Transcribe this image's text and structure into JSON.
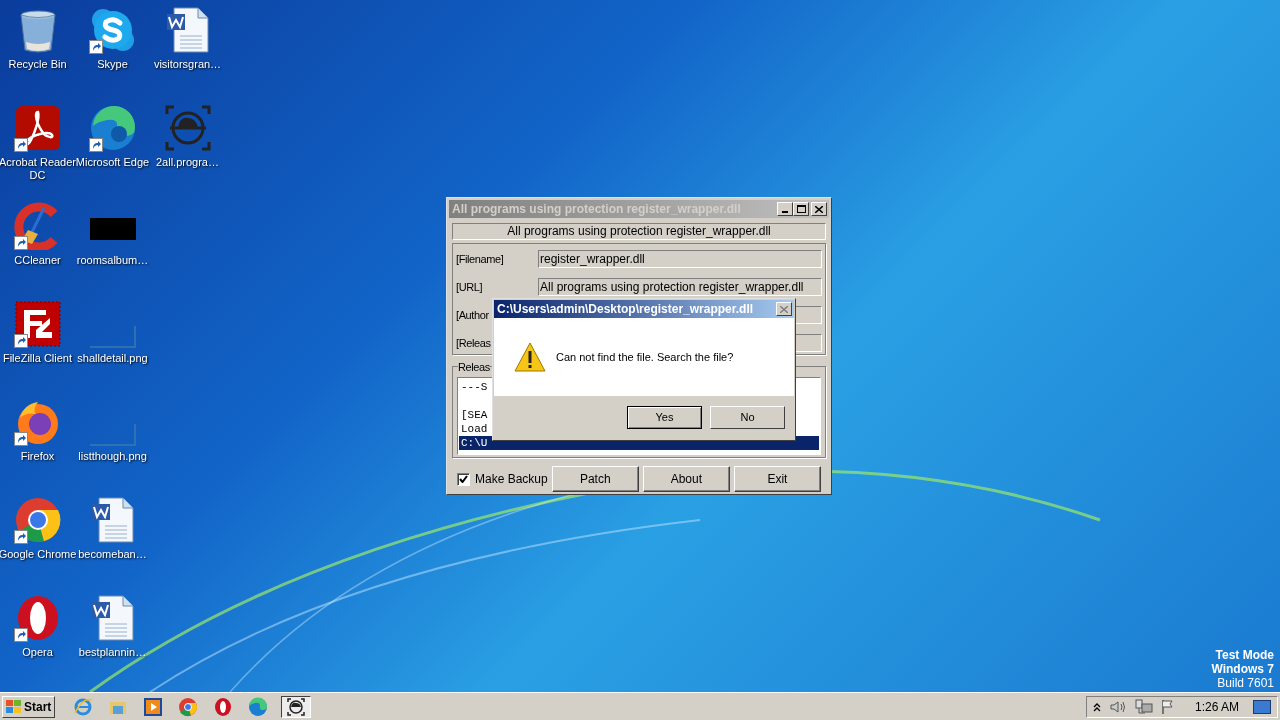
{
  "desktop_icons": [
    {
      "label": "Recycle Bin",
      "kind": "recycle",
      "shortcut": false
    },
    {
      "label": "Acrobat Reader DC",
      "kind": "acrobat",
      "shortcut": true
    },
    {
      "label": "CCleaner",
      "kind": "ccleaner",
      "shortcut": true
    },
    {
      "label": "FileZilla Client",
      "kind": "filezilla",
      "shortcut": true
    },
    {
      "label": "Firefox",
      "kind": "firefox",
      "shortcut": true
    },
    {
      "label": "Google Chrome",
      "kind": "chrome",
      "shortcut": true
    },
    {
      "label": "Opera",
      "kind": "opera",
      "shortcut": true
    },
    {
      "label": "Skype",
      "kind": "skype",
      "shortcut": true
    },
    {
      "label": "Microsoft Edge",
      "kind": "edge",
      "shortcut": true
    },
    {
      "label": "roomsalbum…",
      "kind": "dark-image",
      "shortcut": false
    },
    {
      "label": "shalldetail.png",
      "kind": "blank-image",
      "shortcut": false
    },
    {
      "label": "listthough.png",
      "kind": "blank-image",
      "shortcut": false
    },
    {
      "label": "becomeban…",
      "kind": "word",
      "shortcut": false
    },
    {
      "label": "bestplannin…",
      "kind": "word",
      "shortcut": false
    },
    {
      "label": "visitorsgran…",
      "kind": "word",
      "shortcut": false
    },
    {
      "label": "2all.progra…",
      "kind": "program",
      "shortcut": false
    }
  ],
  "main_window": {
    "title": "All programs using protection register_wrapper.dll",
    "header": "All programs using protection register_wrapper.dll",
    "fields": [
      {
        "label": "[Filename]",
        "value": "register_wrapper.dll"
      },
      {
        "label": "[URL]",
        "value": "All programs using protection register_wrapper.dll"
      },
      {
        "label": "[Author"
      },
      {
        "label": "[Releas"
      }
    ],
    "release_group": "Releas",
    "log_lines": [
      {
        "text": "---S",
        "selected": false
      },
      {
        "text": "[SEA",
        "selected": false
      },
      {
        "text": "Load",
        "selected": false
      },
      {
        "text": "C:\\U",
        "selected": true
      }
    ],
    "make_backup": {
      "label": "Make Backup",
      "checked": true
    },
    "buttons": [
      "Patch",
      "About",
      "Exit"
    ]
  },
  "message_box": {
    "title": "C:\\Users\\admin\\Desktop\\register_wrapper.dll",
    "message": "Can not find the file. Search the file?",
    "buttons": [
      {
        "label": "Yes",
        "default": true
      },
      {
        "label": "No",
        "default": false
      }
    ]
  },
  "watermark_text": [
    "Test Mode",
    "Windows 7",
    "Build 7601"
  ],
  "taskbar": {
    "start": "Start",
    "apps": [
      {
        "kind": "ie",
        "active": false
      },
      {
        "kind": "explorer",
        "active": false
      },
      {
        "kind": "media",
        "active": false
      },
      {
        "kind": "chrome",
        "active": false
      },
      {
        "kind": "opera",
        "active": false
      },
      {
        "kind": "edge",
        "active": false
      },
      {
        "kind": "program",
        "active": true
      }
    ],
    "clock": "1:26 AM"
  }
}
